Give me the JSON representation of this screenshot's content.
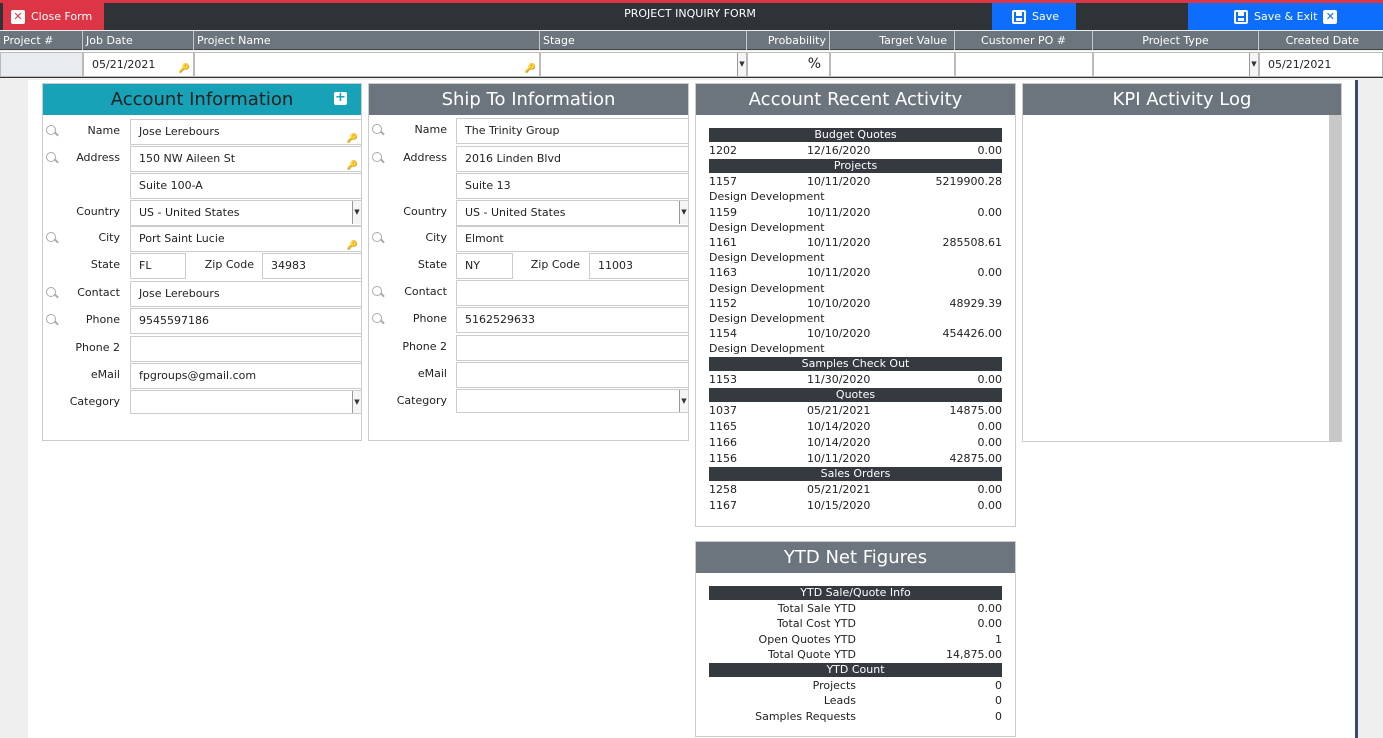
{
  "toolbar": {
    "close_label": "Close Form",
    "title": "PROJECT INQUIRY FORM",
    "save_label": "Save",
    "save_exit_label": "Save & Exit"
  },
  "header": {
    "labels": {
      "project_no": "Project #",
      "job_date": "Job Date",
      "project_name": "Project Name",
      "stage": "Stage",
      "probability": "Probability",
      "target_value": "Target Value",
      "customer_po": "Customer PO #",
      "project_type": "Project Type",
      "created_date": "Created Date"
    },
    "values": {
      "project_no": "",
      "job_date": "05/21/2021",
      "project_name": "",
      "stage": "",
      "probability": "%",
      "target_value": "",
      "customer_po": "",
      "project_type": "",
      "created_date": "05/21/2021"
    }
  },
  "account": {
    "title": "Account Information",
    "labels": {
      "name": "Name",
      "address": "Address",
      "country": "Country",
      "city": "City",
      "state": "State",
      "zip": "Zip Code",
      "contact": "Contact",
      "phone": "Phone",
      "phone2": "Phone 2",
      "email": "eMail",
      "category": "Category"
    },
    "values": {
      "name": "Jose Lerebours",
      "address1": "150 NW Aileen St",
      "address2": "Suite 100-A",
      "country": "US - United States",
      "city": "Port Saint Lucie",
      "state": "FL",
      "zip": "34983",
      "contact": "Jose Lerebours",
      "phone": "9545597186",
      "phone2": "",
      "email": "fpgroups@gmail.com",
      "category": ""
    }
  },
  "shipto": {
    "title": "Ship To Information",
    "labels": {
      "name": "Name",
      "address": "Address",
      "country": "Country",
      "city": "City",
      "state": "State",
      "zip": "Zip Code",
      "contact": "Contact",
      "phone": "Phone",
      "phone2": "Phone 2",
      "email": "eMail",
      "category": "Category"
    },
    "values": {
      "name": "The Trinity Group",
      "address1": "2016 Linden Blvd",
      "address2": "Suite 13",
      "country": "US - United States",
      "city": "Elmont",
      "state": "NY",
      "zip": "11003",
      "contact": "",
      "phone": "5162529633",
      "phone2": "",
      "email": "",
      "category": ""
    }
  },
  "activity": {
    "title": "Account Recent Activity",
    "budget_quotes": {
      "label": "Budget Quotes",
      "rows": [
        {
          "id": "1202",
          "date": "12/16/2020",
          "amount": "0.00"
        }
      ]
    },
    "projects": {
      "label": "Projects",
      "rows": [
        {
          "id": "1157",
          "date": "10/11/2020",
          "amount": "5219900.28",
          "sub": "Design Development"
        },
        {
          "id": "1159",
          "date": "10/11/2020",
          "amount": "0.00",
          "sub": "Design Development"
        },
        {
          "id": "1161",
          "date": "10/11/2020",
          "amount": "285508.61",
          "sub": "Design Development"
        },
        {
          "id": "1163",
          "date": "10/11/2020",
          "amount": "0.00",
          "sub": "Design Development"
        },
        {
          "id": "1152",
          "date": "10/10/2020",
          "amount": "48929.39",
          "sub": "Design Development"
        },
        {
          "id": "1154",
          "date": "10/10/2020",
          "amount": "454426.00",
          "sub": "Design Development"
        }
      ]
    },
    "samples": {
      "label": "Samples Check Out",
      "rows": [
        {
          "id": "1153",
          "date": "11/30/2020",
          "amount": "0.00"
        }
      ]
    },
    "quotes": {
      "label": "Quotes",
      "rows": [
        {
          "id": "1037",
          "date": "05/21/2021",
          "amount": "14875.00"
        },
        {
          "id": "1165",
          "date": "10/14/2020",
          "amount": "0.00"
        },
        {
          "id": "1166",
          "date": "10/14/2020",
          "amount": "0.00"
        },
        {
          "id": "1156",
          "date": "10/11/2020",
          "amount": "42875.00"
        }
      ]
    },
    "sales_orders": {
      "label": "Sales Orders",
      "rows": [
        {
          "id": "1258",
          "date": "05/21/2021",
          "amount": "0.00"
        },
        {
          "id": "1167",
          "date": "10/15/2020",
          "amount": "0.00"
        }
      ]
    }
  },
  "kpi": {
    "title": "KPI Activity Log"
  },
  "ytd": {
    "title": "YTD Net Figures",
    "sale_quote_header": "YTD Sale/Quote Info",
    "sale_quote_rows": [
      {
        "label": "Total Sale YTD",
        "value": "0.00"
      },
      {
        "label": "Total Cost YTD",
        "value": "0.00"
      },
      {
        "label": "Open Quotes YTD",
        "value": "1"
      },
      {
        "label": "Total Quote YTD",
        "value": "14,875.00"
      }
    ],
    "count_header": "YTD Count",
    "count_rows": [
      {
        "label": "Projects",
        "value": "0"
      },
      {
        "label": "Leads",
        "value": "0"
      },
      {
        "label": "Samples Requests",
        "value": "0"
      }
    ]
  }
}
